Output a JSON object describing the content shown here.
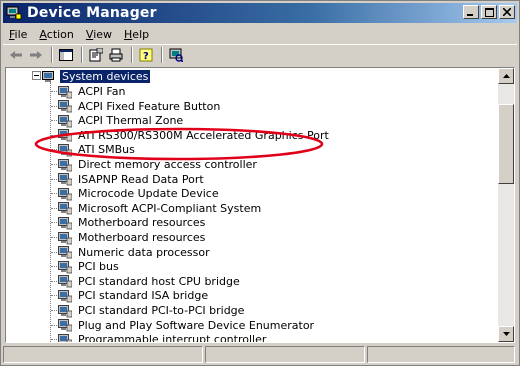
{
  "window": {
    "title": "Device Manager",
    "accent_color": "#0a246a",
    "annotation_color": "#e0001a"
  },
  "menu": [
    {
      "label": "File",
      "mnemonic": "F",
      "rest": "ile"
    },
    {
      "label": "Action",
      "mnemonic": "A",
      "rest": "ction"
    },
    {
      "label": "View",
      "mnemonic": "V",
      "rest": "iew"
    },
    {
      "label": "Help",
      "mnemonic": "H",
      "rest": "elp"
    }
  ],
  "toolbar": {
    "icons": [
      "back-arrow-icon",
      "forward-arrow-icon",
      "show-hide-console-tree-icon",
      "properties-icon",
      "print-icon",
      "help-icon",
      "scan-hardware-icon"
    ]
  },
  "tree": {
    "parent": "System devices",
    "items": [
      "ACPI Fan",
      "ACPI Fixed Feature Button",
      "ACPI Thermal Zone",
      "ATI RS300/RS300M Accelerated Graphics Port",
      "ATI SMBus",
      "Direct memory access controller",
      "ISAPNP Read Data Port",
      "Microcode Update Device",
      "Microsoft ACPI-Compliant System",
      "Motherboard resources",
      "Motherboard resources",
      "Numeric data processor",
      "PCI bus",
      "PCI standard host CPU bridge",
      "PCI standard ISA bridge",
      "PCI standard PCI-to-PCI bridge",
      "Plug and Play Software Device Enumerator",
      "Programmable interrupt controller"
    ]
  }
}
